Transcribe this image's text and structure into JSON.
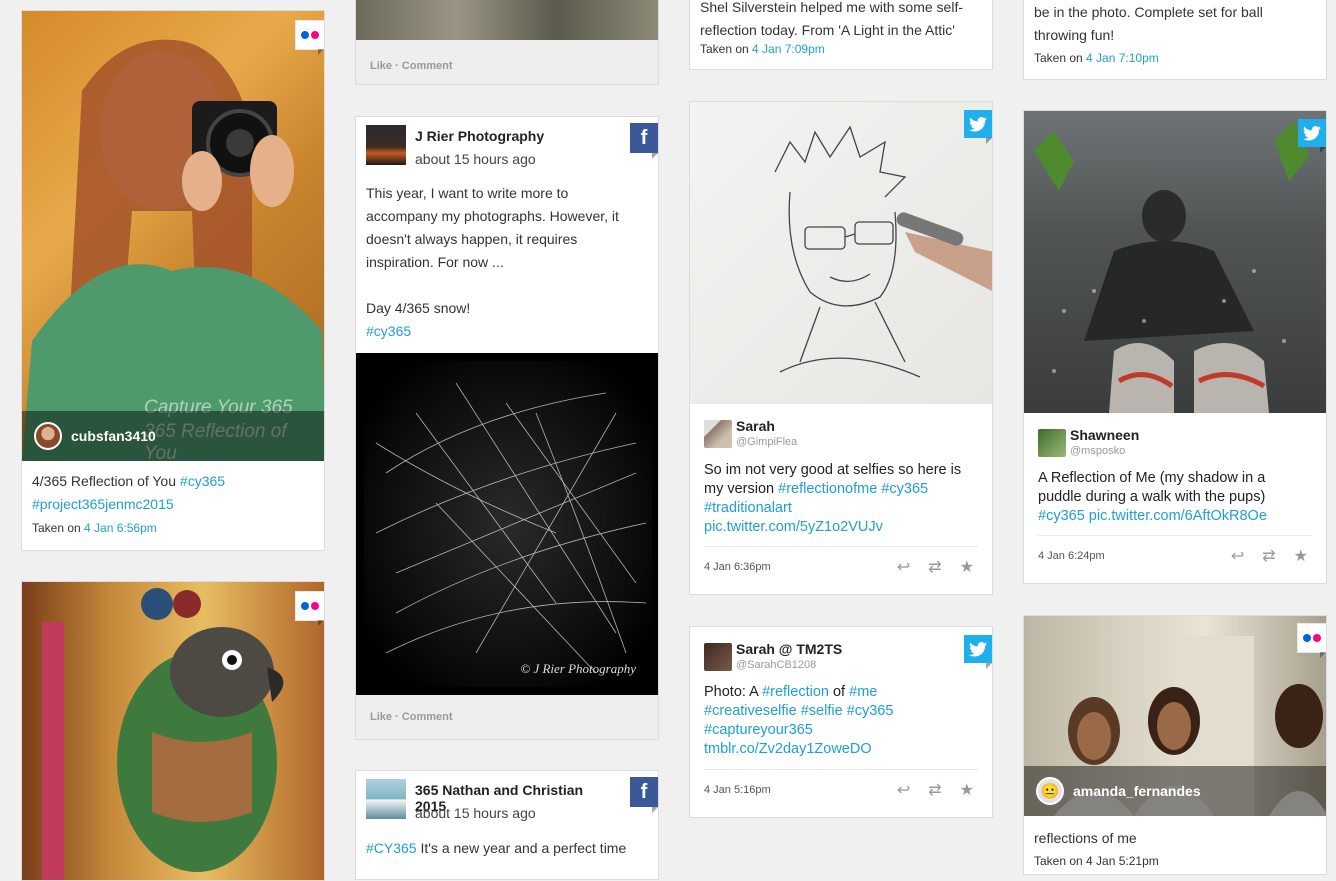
{
  "colors": {
    "link": "#1e9fd6",
    "twitter": "#1fb0ec",
    "facebook": "#3b5998",
    "flickr_blue": "#0063dc",
    "flickr_pink": "#ff0084"
  },
  "col1": {
    "card1": {
      "network": "flickr",
      "username": "cubsfan3410",
      "watermark_line1": "Capture Your 365",
      "watermark_line2": "365 Reflection of You",
      "caption_text": "4/365 Reflection of You ",
      "caption_tag1": "#cy365",
      "caption_tag2": "#project365jenmc2015",
      "taken_label": "Taken on ",
      "taken_date": "4 Jan 6:56pm"
    },
    "card2": {
      "network": "flickr"
    }
  },
  "col2": {
    "card0": {
      "like": "Like",
      "sep": " · ",
      "comment": "Comment"
    },
    "card1": {
      "network": "facebook",
      "name": "J Rier Photography",
      "time": "about 15 hours ago",
      "line1": "This year, I want to write more to",
      "line2": "accompany my photographs. However, it",
      "line3": "doesn't always happen, it requires",
      "line4": "inspiration. For now ...",
      "line5": "Day 4/365 snow!",
      "tag": "#cy365",
      "watermark": "© J Rier Photography",
      "like": "Like",
      "sep": " · ",
      "comment": "Comment"
    },
    "card2": {
      "network": "facebook",
      "name": "365 Nathan and Christian 2015",
      "time": "about 15 hours ago",
      "tag": "#CY365",
      "text": " It's a new year and a perfect time"
    }
  },
  "col3": {
    "card0": {
      "line0": "Shel Silverstein helped me with some self-",
      "line1": "reflection today. From 'A Light in the Attic'",
      "taken_label": "Taken on ",
      "taken_date": "4 Jan 7:09pm"
    },
    "card1": {
      "network": "twitter",
      "name": "Sarah",
      "handle": "@GimpiFlea",
      "text1": "So im not very good at selfies so here is my version ",
      "tag1": "#reflectionofme",
      "tag2": "#cy365",
      "tag3": "#traditionalart",
      "link": "pic.twitter.com/5yZ1o2VUJv",
      "date": "4 Jan 6:36pm"
    },
    "card2": {
      "network": "twitter",
      "name": "Sarah @ TM2TS",
      "handle": "@SarahCB1208",
      "text1": "Photo: A ",
      "tag1": "#reflection",
      "text2": " of ",
      "tag2": "#me",
      "tag3": "#creativeselfie",
      "tag4": "#selfie",
      "tag5": "#cy365",
      "tag6": "#captureyour365",
      "link": "tmblr.co/Zv2day1ZoweDO",
      "date": "4 Jan 5:16pm"
    }
  },
  "col4": {
    "card0": {
      "line1": "be in the photo. Complete set for ball",
      "line2": "throwing fun!",
      "taken_label": "Taken on ",
      "taken_date": "4 Jan 7:10pm"
    },
    "card1": {
      "network": "twitter",
      "name": "Shawneen",
      "handle": "@msposko",
      "text1": "A Reflection of Me (my shadow in a puddle during a walk with the pups) ",
      "tag1": "#cy365",
      "link": "pic.twitter.com/6AftOkR8Oe",
      "date": "4 Jan 6:24pm"
    },
    "card2": {
      "network": "flickr",
      "username": "amanda_fernandes",
      "caption_text": "reflections of me",
      "taken_partial": "Taken on 4 Jan 5:21pm"
    }
  },
  "icons": {
    "reply": "reply-icon",
    "retweet": "retweet-icon",
    "favorite": "star-icon",
    "facebook": "facebook-icon",
    "twitter": "twitter-bird-icon",
    "flickr": "flickr-icon"
  }
}
